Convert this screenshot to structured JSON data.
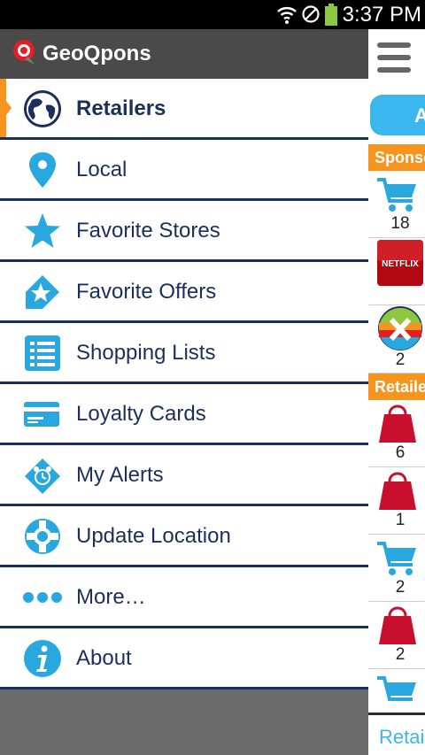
{
  "status_bar": {
    "time": "3:37 PM"
  },
  "app": {
    "title": "GeoQpons"
  },
  "menu": [
    {
      "label": "Retailers",
      "icon": "globe-icon",
      "active": true
    },
    {
      "label": "Local",
      "icon": "location-pin-icon"
    },
    {
      "label": "Favorite Stores",
      "icon": "star-icon"
    },
    {
      "label": "Favorite Offers",
      "icon": "star-tag-icon"
    },
    {
      "label": "Shopping Lists",
      "icon": "list-icon"
    },
    {
      "label": "Loyalty Cards",
      "icon": "card-icon"
    },
    {
      "label": "My Alerts",
      "icon": "alarm-clock-icon"
    },
    {
      "label": "Update Location",
      "icon": "crosshair-icon"
    },
    {
      "label": "More…",
      "icon": "more-dots-icon"
    },
    {
      "label": "About",
      "icon": "info-icon"
    }
  ],
  "peek": {
    "pill_letter": "A",
    "sponsored_label": "Sponso",
    "retailers_label": "Retaile",
    "bottom_tab": "Retai",
    "sponsored_counts": [
      "18",
      "",
      "2"
    ],
    "retailer_counts": [
      "6",
      "1",
      "2",
      "2"
    ],
    "netflix_logo": "NETFLIX"
  },
  "colors": {
    "accent": "#f7941d",
    "navy": "#1b2f5c",
    "icon_blue": "#29a8e0",
    "bag_red": "#c8102e"
  }
}
